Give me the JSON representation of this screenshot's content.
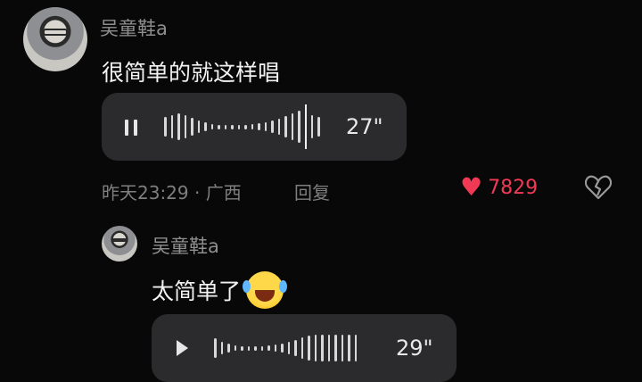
{
  "comment1": {
    "username": "吴童鞋a",
    "text": "很简单的就这样唱",
    "voice_duration": "27\"",
    "timestamp": "昨天23:29 · 广西",
    "reply_label": "回复",
    "likes": "7829"
  },
  "comment2": {
    "username": "吴童鞋a",
    "text": "太简单了",
    "voice_duration": "29\""
  },
  "colors": {
    "background": "#080808",
    "like_red": "#f03a55",
    "bubble": "#2b2b2d"
  }
}
